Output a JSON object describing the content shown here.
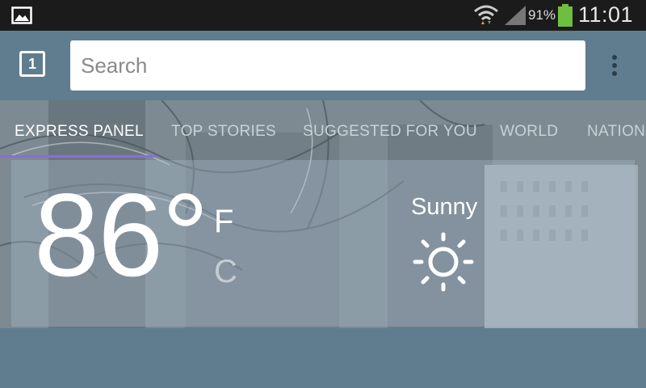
{
  "status_bar": {
    "battery_percent": "91%",
    "time": "11:01",
    "icons": [
      "gallery-icon",
      "wifi-icon",
      "signal-icon",
      "battery-icon"
    ]
  },
  "toolbar": {
    "tab_count": "1",
    "search_placeholder": "Search",
    "menu_icon": "overflow-menu-icon"
  },
  "tabs": [
    {
      "label": "EXPRESS PANEL",
      "active": true
    },
    {
      "label": "TOP STORIES",
      "active": false
    },
    {
      "label": "SUGGESTED FOR YOU",
      "active": false
    },
    {
      "label": "WORLD",
      "active": false
    },
    {
      "label": "NATION",
      "active": false
    }
  ],
  "weather": {
    "temperature": "86°",
    "unit_f": "F",
    "unit_c": "C",
    "condition": "Sunny",
    "condition_icon": "sun-icon"
  },
  "colors": {
    "accent": "#8a6ddb",
    "toolbar": "#5f7d8e",
    "status_bar": "#1b1b1b"
  }
}
